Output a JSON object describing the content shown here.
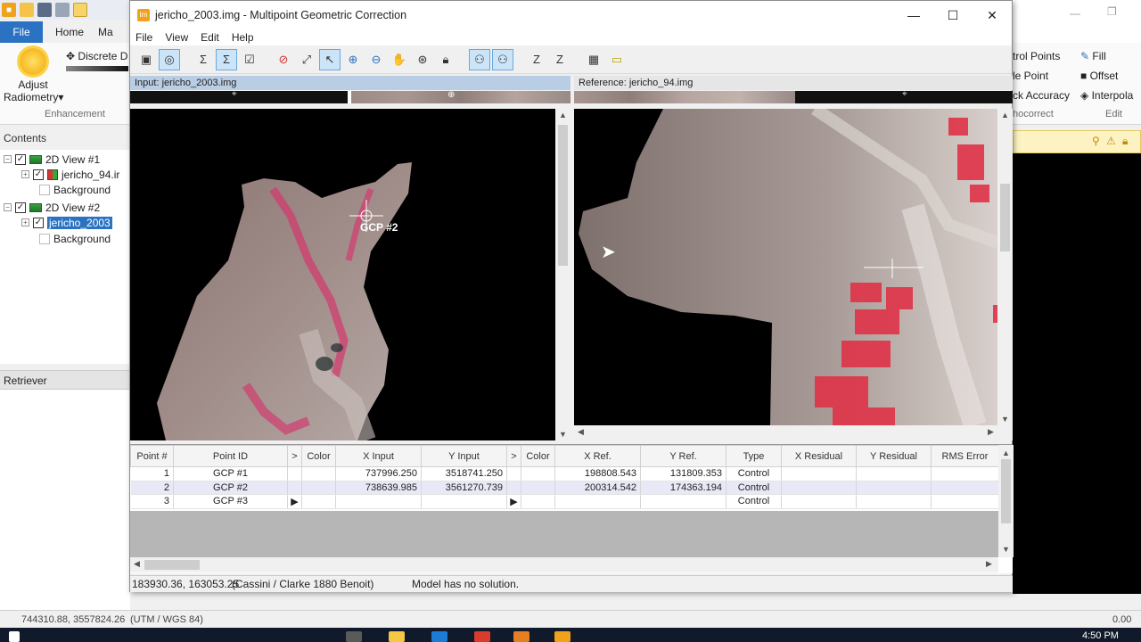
{
  "background_app": {
    "file_tab": "File",
    "home_tab": "Home",
    "extra_tab": "Ma",
    "adjust_label": "Adjust",
    "radiometry_label": "Radiometry",
    "discrete_label": "Discrete D",
    "enhancement_group": "Enhancement",
    "contents_title": "Contents",
    "tree": {
      "view1": "2D View #1",
      "view1_img": "jericho_94.ir",
      "view1_bg": "Background",
      "view2": "2D View #2",
      "view2_img": "jericho_2003",
      "view2_bg": "Background"
    },
    "retriever_title": "Retriever",
    "right_ribbon": {
      "control_points": "trol Points",
      "point": "le Point",
      "accuracy": "ck Accuracy",
      "correct": "hocorrect",
      "fill": "Fill",
      "offset": "Offset",
      "interpolate": "Interpola",
      "edit_group": "Edit"
    },
    "status_coords": "744310.88, 3557824.26",
    "status_proj": "(UTM / WGS 84)",
    "status_right": "0.00",
    "clock": "4:50 PM"
  },
  "dialog": {
    "title": "jericho_2003.img - Multipoint Geometric Correction",
    "menu": [
      "File",
      "View",
      "Edit",
      "Help"
    ],
    "input_header": "Input: jericho_2003.img",
    "reference_header": "Reference: jericho_94.img",
    "gcp_label_input": "GCP #2",
    "table": {
      "headers": [
        "Point #",
        "Point ID",
        ">",
        "Color",
        "X Input",
        "Y Input",
        ">",
        "Color",
        "X Ref.",
        "Y Ref.",
        "Type",
        "X Residual",
        "Y Residual",
        "RMS Error"
      ],
      "rows": [
        {
          "num": "1",
          "id": "GCP #1",
          "x_input": "737996.250",
          "y_input": "3518741.250",
          "x_ref": "198808.543",
          "y_ref": "131809.353",
          "type": "Control"
        },
        {
          "num": "2",
          "id": "GCP #2",
          "x_input": "738639.985",
          "y_input": "3561270.739",
          "x_ref": "200314.542",
          "y_ref": "174363.194",
          "type": "Control"
        },
        {
          "num": "3",
          "id": "GCP #3",
          "x_input": "",
          "y_input": "",
          "x_ref": "",
          "y_ref": "",
          "type": "Control"
        }
      ]
    },
    "status_coords": "183930.36, 163053.25",
    "status_proj": "(Cassini / Clarke 1880 Benoit)",
    "status_msg": "Model has no solution."
  }
}
